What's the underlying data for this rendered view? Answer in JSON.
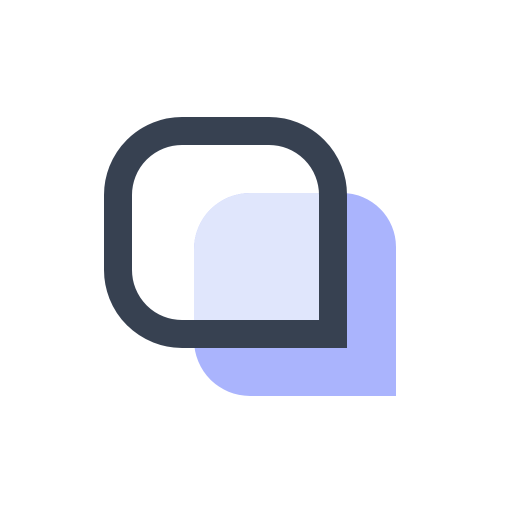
{
  "icon": {
    "name": "chat-bubbles-icon",
    "colors": {
      "background": "#ffffff",
      "back_bubble": "#aab4fd",
      "overlap": "#e0e6fc",
      "front_outline": "#374151"
    }
  }
}
